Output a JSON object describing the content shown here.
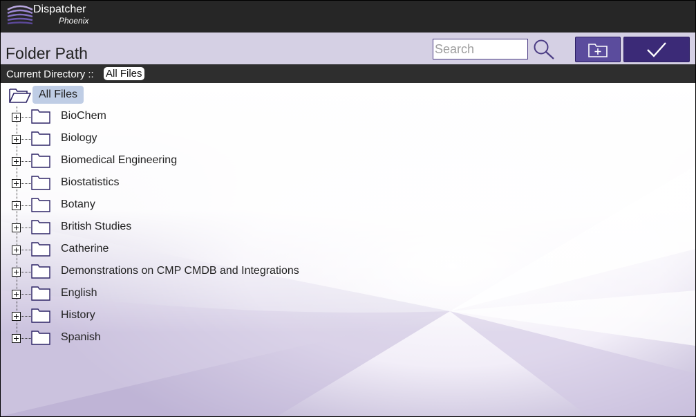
{
  "app": {
    "brand": "Dispatcher",
    "brand_sub": "Phoenix"
  },
  "header": {
    "title": "Folder Path",
    "search_placeholder": "Search"
  },
  "directory": {
    "label": "Current Directory ::",
    "current": "All Files"
  },
  "tree": {
    "root": "All Files",
    "folders": [
      "BioChem",
      "Biology",
      "Biomedical Engineering",
      "Biostatistics",
      "Botany",
      "British Studies",
      "Catherine",
      "Demonstrations on CMP CMDB and Integrations",
      "English",
      "History",
      "Spanish"
    ]
  },
  "icons": {
    "logo": "dispatcher-logo-icon",
    "search": "search-icon",
    "add_folder": "add-folder-icon",
    "confirm": "checkmark-icon",
    "folder": "folder-icon",
    "folder_open": "folder-open-icon",
    "expand": "plus-expander-icon"
  },
  "colors": {
    "accent": "#3b2a77",
    "accent_light": "#5b4c9d",
    "header_bg": "#d5d0e4",
    "topbar_bg": "#262626",
    "root_chip": "#bfcde5"
  }
}
